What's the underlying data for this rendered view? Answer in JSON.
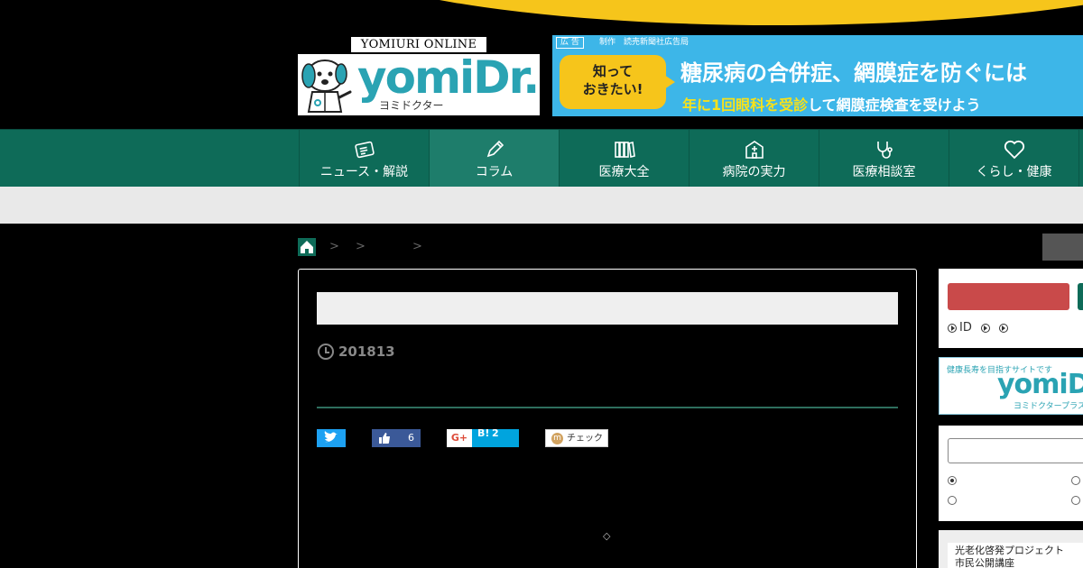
{
  "header": {
    "online_label": "YOMIURI ONLINE",
    "logo_word": "yomiDr.",
    "logo_kana": "ヨミドクター"
  },
  "ad": {
    "tag": "広 告",
    "credit": "制作　読売新聞社広告局",
    "bubble": "知って\nおきたい!",
    "headline": "糖尿病の合併症、網膜症を防ぐには",
    "sub_highlight": "年に1回眼科を受診",
    "sub_rest": "して網膜症検査を受けよう"
  },
  "nav": {
    "items": [
      {
        "label": "ニュース・解説",
        "icon": "newspaper-icon"
      },
      {
        "label": "コラム",
        "icon": "pencil-icon"
      },
      {
        "label": "医療大全",
        "icon": "books-icon"
      },
      {
        "label": "病院の実力",
        "icon": "hospital-icon"
      },
      {
        "label": "医療相談室",
        "icon": "stethoscope-icon"
      },
      {
        "label": "くらし・健康",
        "icon": "heart-icon"
      }
    ],
    "active_index": 1
  },
  "breadcrumb": {
    "separators": [
      ">",
      ">",
      ">"
    ]
  },
  "article": {
    "date": "201813",
    "share": {
      "facebook_count": "6",
      "google_label": "G+",
      "hatena_label": "B!",
      "hatena_count": "2",
      "mixi_label": "チェック"
    },
    "marker": "◇"
  },
  "sidebar": {
    "login_links": {
      "id_label": "ID"
    },
    "plus": {
      "tagline": "健康長寿を目指すサイトです",
      "word": "yomiDr.",
      "kana": "ヨミドクタープラス"
    },
    "promo": {
      "line1": "光老化啓発プロジェクト",
      "line2": "市民公開講座"
    }
  },
  "colors": {
    "nav_green": "#0e6b58",
    "brand_cyan": "#2aa3b3",
    "yellow": "#f6c51b",
    "login_red": "#c94a4a"
  }
}
